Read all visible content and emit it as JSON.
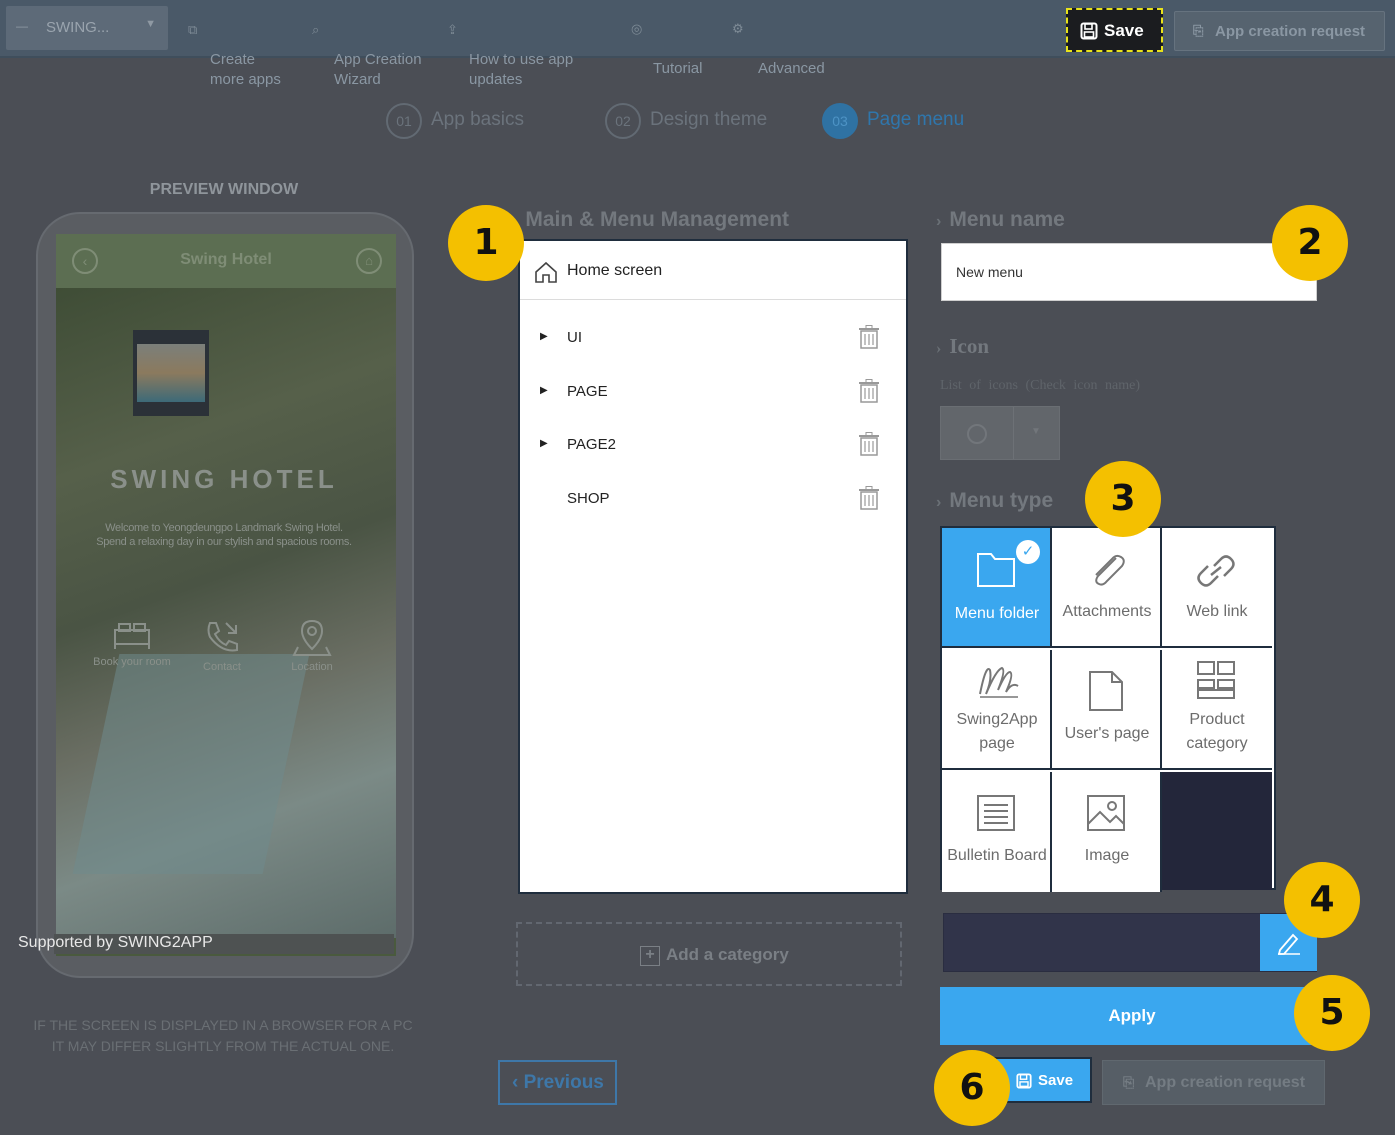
{
  "topbar": {
    "app_selector": "SWING...",
    "nav": [
      {
        "label": "Create\nmore apps",
        "icon": "copy-icon"
      },
      {
        "label": "App Creation\nWizard",
        "icon": "wand-icon"
      },
      {
        "label": "How to use app\nupdates",
        "icon": "upload-icon"
      },
      {
        "label": "Tutorial",
        "icon": "play-circle-icon"
      },
      {
        "label": "Advanced",
        "icon": "gear-icon"
      }
    ],
    "save_label": "Save",
    "request_label": "App creation request"
  },
  "steps": [
    {
      "num": "01",
      "label": "App basics",
      "active": false
    },
    {
      "num": "02",
      "label": "Design theme",
      "active": false
    },
    {
      "num": "03",
      "label": "Page menu",
      "active": true
    }
  ],
  "preview": {
    "title": "PREVIEW WINDOW",
    "header_title": "Swing Hotel",
    "hotel_name": "SWING HOTEL",
    "hotel_desc": "Welcome to Yeongdeungpo Landmark Swing Hotel.\nSpend a relaxing day in our stylish and spacious rooms.",
    "icons": [
      {
        "label": "Book your room",
        "icon": "bed-icon"
      },
      {
        "label": "Contact",
        "icon": "phone-icon"
      },
      {
        "label": "Location",
        "icon": "location-pin-icon"
      }
    ],
    "footer": "Supported by SWING2APP",
    "note": "IF THE SCREEN IS DISPLAYED IN A BROWSER FOR A PC\nIT MAY DIFFER SLIGHTLY FROM THE ACTUAL ONE."
  },
  "management": {
    "title": "Main & Menu Management",
    "home": "Home screen",
    "items": [
      {
        "label": "UI",
        "expandable": true
      },
      {
        "label": "PAGE",
        "expandable": true
      },
      {
        "label": "PAGE2",
        "expandable": true
      },
      {
        "label": "SHOP",
        "expandable": false
      }
    ],
    "add_category": "Add a category",
    "previous": "Previous"
  },
  "menu_name": {
    "title": "Menu name",
    "value": "New menu"
  },
  "icon_section": {
    "title": "Icon",
    "hint": "List of icons (Check icon name)"
  },
  "menu_type": {
    "title": "Menu type",
    "options": [
      {
        "label": "Menu folder",
        "active": true
      },
      {
        "label": "Attachments",
        "active": false
      },
      {
        "label": "Web link",
        "active": false
      },
      {
        "label": "Swing2App\npage",
        "active": false
      },
      {
        "label": "User's page",
        "active": false
      },
      {
        "label": "Product\ncategory",
        "active": false
      },
      {
        "label": "Bulletin Board",
        "active": false
      },
      {
        "label": "Image",
        "active": false
      }
    ]
  },
  "color": {
    "value_hex": "#31344a",
    "accent": "#3aa7ef"
  },
  "apply_label": "Apply",
  "bottom": {
    "save_label": "Save",
    "request_label": "App creation request"
  },
  "callouts": [
    "1",
    "2",
    "3",
    "4",
    "5",
    "6"
  ]
}
